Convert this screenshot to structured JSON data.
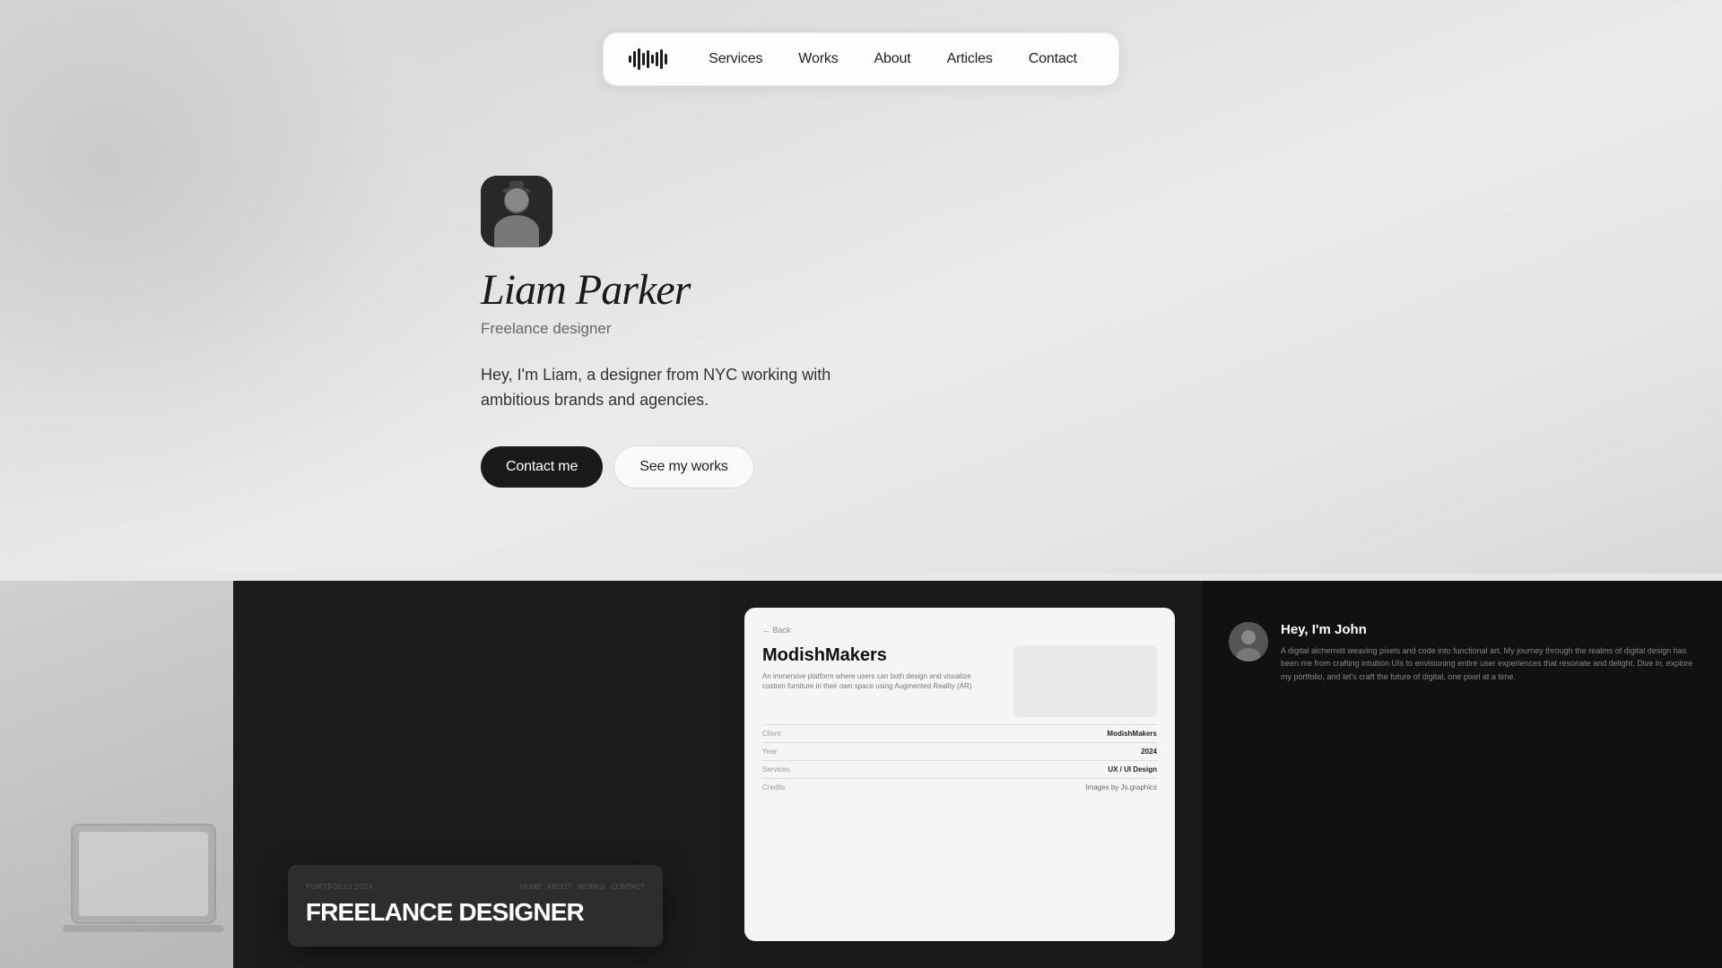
{
  "navbar": {
    "logo_alt": "Logo waveform icon",
    "links": [
      {
        "label": "Services",
        "id": "services"
      },
      {
        "label": "Works",
        "id": "works"
      },
      {
        "label": "About",
        "id": "about"
      },
      {
        "label": "Articles",
        "id": "articles"
      },
      {
        "label": "Contact",
        "id": "contact"
      }
    ]
  },
  "hero": {
    "name": "Liam Parker",
    "subtitle": "Freelance designer",
    "description": "Hey, I'm Liam, a designer from NYC working with ambitious brands and agencies.",
    "btn_primary": "Contact me",
    "btn_secondary": "See my works"
  },
  "portfolio": {
    "card2": {
      "label": "PORTFOLIO 2024",
      "title": "FREELANCE DESIGNER"
    },
    "card3": {
      "back": "← Back",
      "heading": "ModishMakers",
      "description": "An immersive platform where users can both design and visualize custom furniture in their own space using Augmented Reality (AR)",
      "rows": [
        {
          "label": "Client",
          "value": "ModishMakers"
        },
        {
          "label": "Year",
          "value": "2024"
        },
        {
          "label": "Services",
          "value": "UX / UI Design"
        },
        {
          "label": "Credits",
          "value": "Images by Js.graphics"
        }
      ]
    },
    "card4": {
      "greeting": "Hey, I'm John",
      "description": "A digital alchemist weaving pixels and code into functional art. My journey through the realms of digital design has been me from crafting intuition UIs to envisioning entire user experiences that resonate and delight. Dive in, explore my portfolio, and let's craft the future of digital, one pixel at a time."
    }
  },
  "colors": {
    "primary_btn_bg": "#1a1a1a",
    "primary_btn_text": "#ffffff",
    "nav_bg": "rgba(255,255,255,0.92)",
    "hero_name_color": "#1a1a1a",
    "hero_subtitle_color": "#666666"
  }
}
